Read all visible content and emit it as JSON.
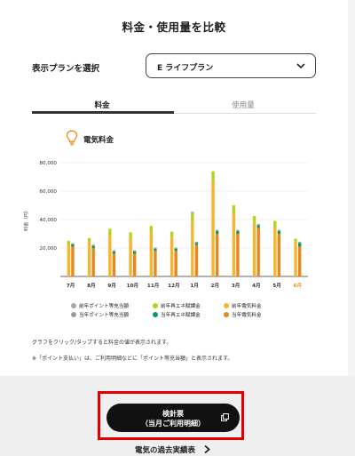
{
  "page": {
    "title": "料金・使用量を比較"
  },
  "plan": {
    "label": "表示プランを選択",
    "selected": "E ライフプラン"
  },
  "tabs": [
    {
      "label": "料金",
      "active": true
    },
    {
      "label": "使用量",
      "active": false
    }
  ],
  "section": {
    "title": "電気料金",
    "icon": "lightbulb-icon"
  },
  "colors": {
    "prev_point": "#a9a9a9",
    "prev_renewable": "#b3d41e",
    "prev_electricity": "#f7b52c",
    "cur_point": "#9b9b9b",
    "cur_renewable": "#0a9b63",
    "cur_electricity": "#e8861f",
    "current_month_label": "#f08c1a"
  },
  "chart_data": {
    "type": "bar",
    "ylabel": "料金（円）",
    "ylim": [
      0,
      80000
    ],
    "yticks": [
      "20,000",
      "40,000",
      "60,000",
      "80,000"
    ],
    "ytick_values": [
      20000,
      40000,
      60000,
      80000
    ],
    "categories": [
      "7月",
      "8月",
      "9月",
      "10月",
      "11月",
      "12月",
      "1月",
      "2月",
      "3月",
      "4月",
      "5月",
      "6月"
    ],
    "current_month": "6月",
    "series": [
      {
        "name": "前年電気料金",
        "group": "prev",
        "values": [
          22500,
          24000,
          29000,
          27500,
          31000,
          28000,
          39000,
          67000,
          45000,
          38000,
          35000,
          24500
        ]
      },
      {
        "name": "前年再エネ賦課金",
        "group": "prev",
        "values": [
          2500,
          3000,
          4500,
          3500,
          4500,
          3500,
          5000,
          7000,
          5000,
          4500,
          4000,
          2000
        ]
      },
      {
        "name": "前年ポイント等充当額",
        "group": "prev",
        "values": [
          0,
          0,
          0,
          0,
          0,
          0,
          1500,
          0,
          0,
          0,
          0,
          0
        ]
      },
      {
        "name": "当年電気料金",
        "group": "cur",
        "values": [
          21000,
          20000,
          16000,
          16000,
          18000,
          18000,
          22000,
          30000,
          30000,
          34000,
          30000,
          21000
        ]
      },
      {
        "name": "当年再エネ賦課金",
        "group": "cur",
        "values": [
          1500,
          1500,
          1500,
          1500,
          1500,
          1500,
          1500,
          2000,
          2000,
          2000,
          2000,
          2500
        ]
      },
      {
        "name": "当年ポイント等充当額",
        "group": "cur",
        "values": [
          800,
          800,
          800,
          800,
          800,
          800,
          800,
          800,
          800,
          800,
          800,
          800
        ]
      }
    ]
  },
  "legend": [
    {
      "label": "前年ポイント等充当額",
      "color_key": "prev_point"
    },
    {
      "label": "前年再エネ賦課金",
      "color_key": "prev_renewable"
    },
    {
      "label": "前年電気料金",
      "color_key": "prev_electricity"
    },
    {
      "label": "当年ポイント等充当額",
      "color_key": "cur_point"
    },
    {
      "label": "当年再エネ賦課金",
      "color_key": "cur_renewable"
    },
    {
      "label": "当年電気料金",
      "color_key": "cur_electricity"
    }
  ],
  "notes": [
    "グラフをクリック/タップすると料金の値が表示されます。",
    "※「ポイント支払い」は、ご利用明細などに「ポイント等充当額」と表示されます。"
  ],
  "meter_button": {
    "line1": "検針票",
    "line2": "（当月ご利用明細）",
    "icon": "external-link-icon"
  },
  "past_link": {
    "label": "電気の過去実績表",
    "icon": "chevron-right-icon"
  }
}
